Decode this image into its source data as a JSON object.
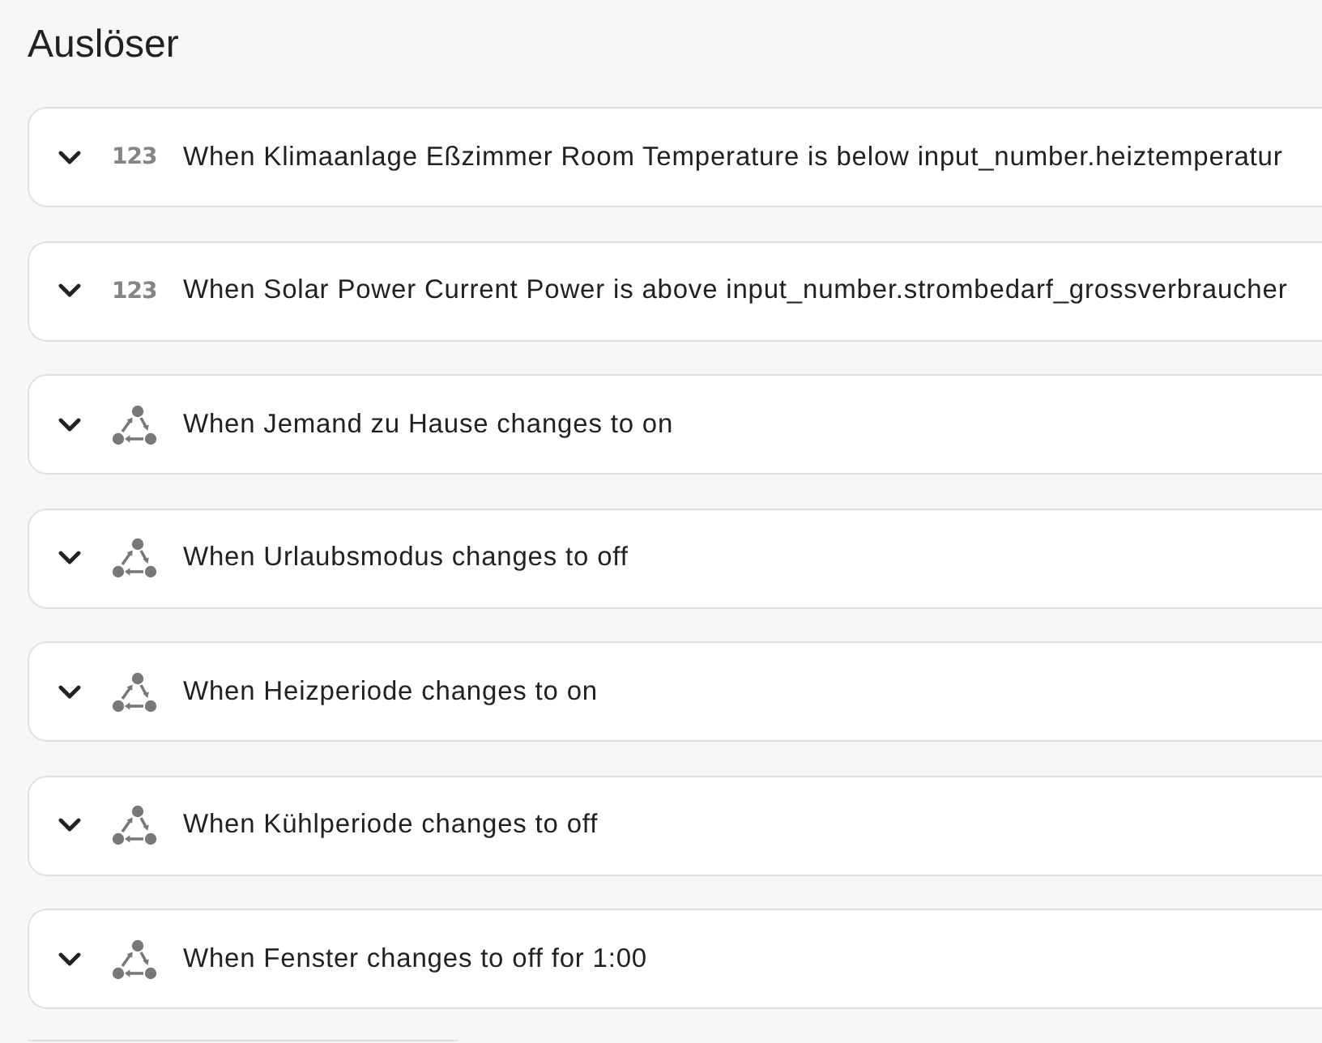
{
  "section": {
    "title": "Auslöser"
  },
  "triggers": [
    {
      "kind": "numeric",
      "icon_glyph": "123",
      "text": "When Klimaanlage Eßzimmer Room Temperature is below input_number.heiztemperatur",
      "expanded": false
    },
    {
      "kind": "numeric",
      "icon_glyph": "123",
      "text": "When Solar Power Current Power is above input_number.strombedarf_grossverbraucher",
      "expanded": false
    },
    {
      "kind": "state",
      "text": "When Jemand zu Hause changes to on",
      "expanded": false
    },
    {
      "kind": "state",
      "text": "When Urlaubsmodus changes to off",
      "expanded": false
    },
    {
      "kind": "state",
      "text": "When Heizperiode changes to on",
      "expanded": false
    },
    {
      "kind": "state",
      "text": "When Kühlperiode changes to off",
      "expanded": false
    },
    {
      "kind": "state",
      "text": "When Fenster changes to off for 1:00",
      "expanded": false
    }
  ]
}
